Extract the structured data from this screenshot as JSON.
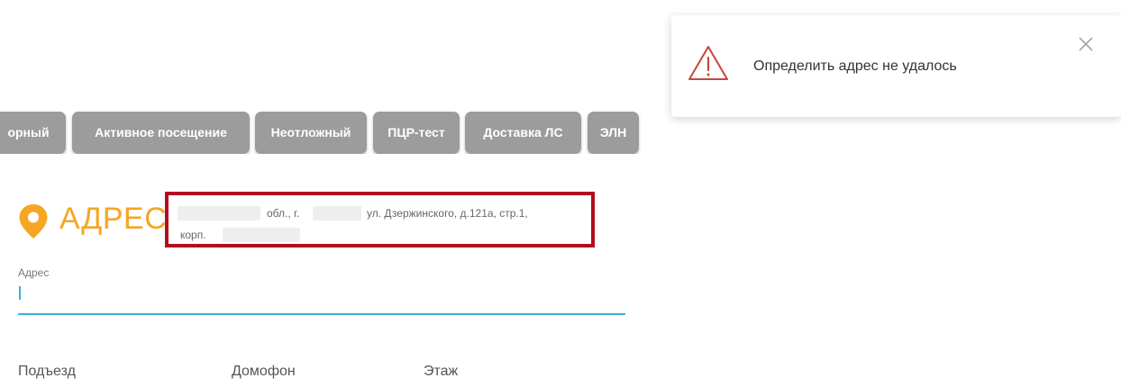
{
  "tabs": [
    {
      "label": "орный"
    },
    {
      "label": "Активное посещение"
    },
    {
      "label": "Неотложный"
    },
    {
      "label": "ПЦР-тест"
    },
    {
      "label": "Доставка ЛС"
    },
    {
      "label": "ЭЛН"
    }
  ],
  "address_section": {
    "title": "АДРЕС",
    "icon": "map-pin-icon",
    "found_address_line1_part1": "обл., г.",
    "found_address_line1_part2": "ул. Дзержинского, д.121а, стр.1,",
    "found_address_line2": "корп."
  },
  "address_field": {
    "label": "Адрес",
    "value": ""
  },
  "lower_fields": {
    "entrance_label": "Подъезд",
    "intercom_label": "Домофон",
    "floor_label": "Этаж"
  },
  "toast": {
    "icon": "warning-icon",
    "message": "Определить адрес не удалось",
    "close_icon": "close-icon"
  },
  "colors": {
    "accent_orange": "#f5a623",
    "highlight_red": "#b30d1e",
    "input_underline": "#39b2d8",
    "tab_gray": "#9c9c9c",
    "warning_red": "#c8463a"
  }
}
